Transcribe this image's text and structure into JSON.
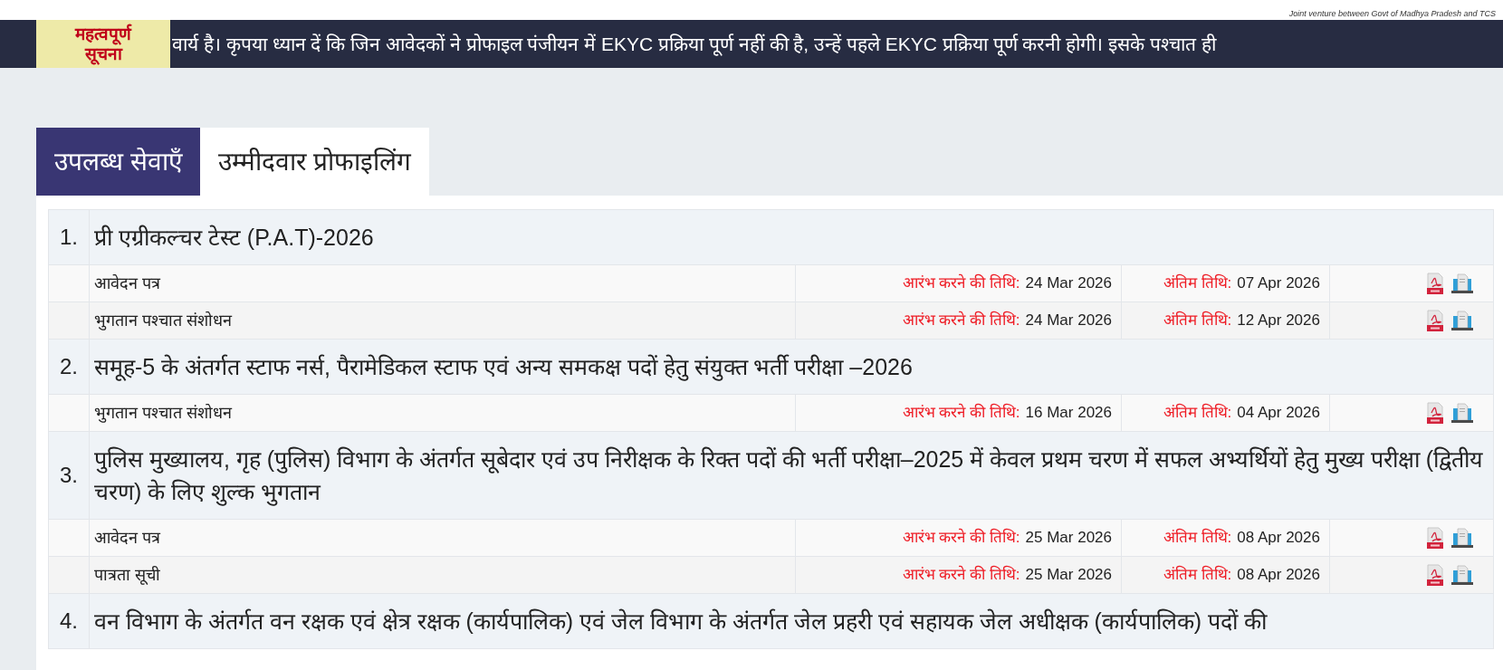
{
  "header": {
    "tagline": "Joint venture between Govt of Madhya Pradesh and TCS"
  },
  "notice": {
    "label": "महत्वपूर्ण सूचना",
    "text": "वार्य है। कृपया ध्यान दें कि जिन आवेदकों ने प्रोफाइल पंजीयन में EKYC प्रक्रिया पूर्ण नहीं की है, उन्हें पहले EKYC प्रक्रिया पूर्ण करनी होगी। इसके पश्चात ही"
  },
  "tabs": [
    {
      "label": "उपलब्ध सेवाएँ",
      "selected": true
    },
    {
      "label": "उम्मीदवार प्रोफाइलिंग",
      "selected": false
    }
  ],
  "services": [
    {
      "number": "1.",
      "title": "प्री एग्रीकल्चर टेस्ट (P.A.T)-2026",
      "items": [
        {
          "name": "आवेदन पत्र",
          "start_label": "आरंभ करने की तिथि:",
          "start_date": "24 Mar 2026",
          "end_label": "अंतिम तिथि:",
          "end_date": "07 Apr 2026"
        },
        {
          "name": "भुगतान पश्चात संशोधन",
          "start_label": "आरंभ करने की तिथि:",
          "start_date": "24 Mar 2026",
          "end_label": "अंतिम तिथि:",
          "end_date": "12 Apr 2026"
        }
      ]
    },
    {
      "number": "2.",
      "title": "समूह-5 के अंतर्गत स्टाफ नर्स, पैरामेडिकल स्टाफ एवं अन्य समकक्ष पदों हेतु संयुक्त भर्ती परीक्षा –2026",
      "items": [
        {
          "name": "भुगतान पश्चात संशोधन",
          "start_label": "आरंभ करने की तिथि:",
          "start_date": "16 Mar 2026",
          "end_label": "अंतिम तिथि:",
          "end_date": "04 Apr 2026"
        }
      ]
    },
    {
      "number": "3.",
      "title": "पुलिस मुख्यालय, गृह (पुलिस) विभाग के अंतर्गत सूबेदार एवं उप निरीक्षक के रिक्त पदों की भर्ती परीक्षा–2025 में केवल प्रथम चरण में सफल अभ्यर्थियों हेतु मुख्य परीक्षा (द्वितीय चरण) के लिए शुल्क भुगतान",
      "items": [
        {
          "name": "आवेदन पत्र",
          "start_label": "आरंभ करने की तिथि:",
          "start_date": "25 Mar 2026",
          "end_label": "अंतिम तिथि:",
          "end_date": "08 Apr 2026"
        },
        {
          "name": "पात्रता सूची",
          "start_label": "आरंभ करने की तिथि:",
          "start_date": "25 Mar 2026",
          "end_label": "अंतिम तिथि:",
          "end_date": "08 Apr 2026"
        }
      ]
    },
    {
      "number": "4.",
      "title": "वन विभाग के अंतर्गत वन रक्षक एवं क्षेत्र रक्षक (कार्यपालिक) एवं जेल विभाग के अंतर्गत जेल प्रहरी एवं सहायक जेल अधीक्षक (कार्यपालिक) पदों की"
    }
  ]
}
